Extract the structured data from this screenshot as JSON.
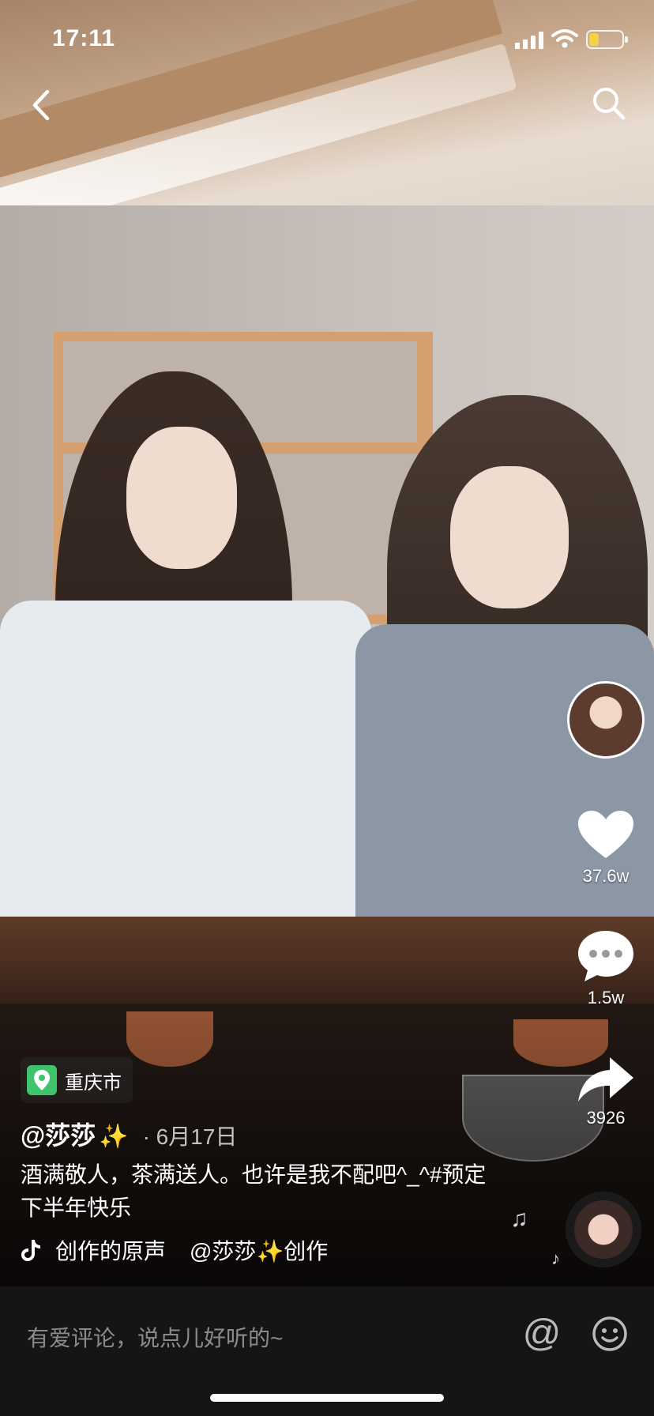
{
  "status_bar": {
    "time": "17:11",
    "battery_fraction": 0.3
  },
  "header": {
    "back_icon": "chevron-left-icon",
    "search_icon": "search-icon"
  },
  "right_rail": {
    "like_count": "37.6w",
    "comment_count": "1.5w",
    "share_count": "3926"
  },
  "location": {
    "label": "重庆市"
  },
  "post": {
    "author": "@莎莎",
    "author_emoji": "✨",
    "date": "· 6月17日",
    "caption": "酒满敬人，茶满送人。也许是我不配吧^_^#预定下半年快乐",
    "music_title": "创作的原声",
    "music_author": "@莎莎✨创作"
  },
  "comment_bar": {
    "placeholder": "有爱评论，说点儿好听的~",
    "at_symbol": "@"
  },
  "colors": {
    "location_green": "#3fc36b",
    "battery_yellow": "#f2d34a"
  }
}
